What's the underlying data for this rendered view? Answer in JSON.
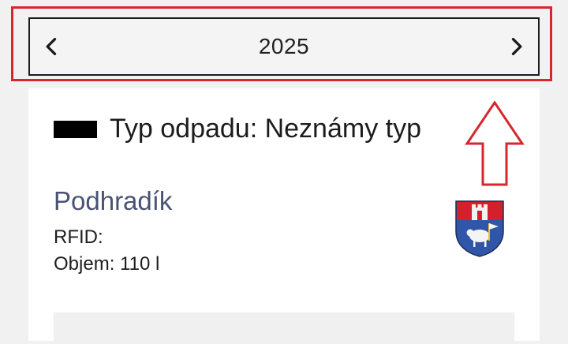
{
  "year_nav": {
    "year": "2025",
    "prev_icon": "chevron-left-icon",
    "next_icon": "chevron-right-icon"
  },
  "card": {
    "type_label": "Typ odpadu: Neznámy typ",
    "type_color": "#000000",
    "location": "Podhradík",
    "rfid_label": "RFID:",
    "volume_label": "Objem: 110 l",
    "crest_icon": "municipal-crest-icon"
  },
  "annotation": {
    "color": "#d7262d",
    "arrow_icon": "up-arrow-annotation-icon"
  }
}
